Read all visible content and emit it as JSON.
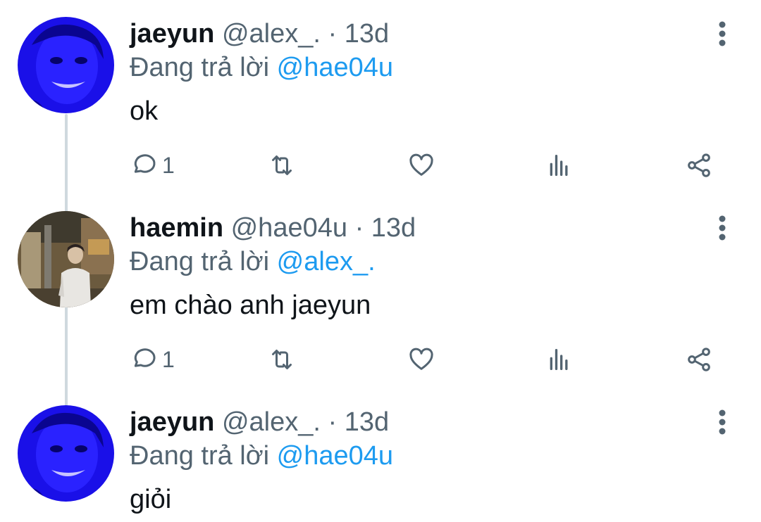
{
  "tweets": [
    {
      "name": "jaeyun",
      "handle": "@alex_.",
      "dot": "·",
      "time": "13d",
      "reply_prefix": "Đang trả lời",
      "reply_to": "@hae04u",
      "text": "ok",
      "reply_count": "1",
      "avatar": "blue-tinted-face"
    },
    {
      "name": "haemin",
      "handle": "@hae04u",
      "dot": "·",
      "time": "13d",
      "reply_prefix": "Đang trả lời",
      "reply_to": "@alex_.",
      "text": "em chào anh jaeyun",
      "reply_count": "1",
      "avatar": "person-in-street-photo"
    },
    {
      "name": "jaeyun",
      "handle": "@alex_.",
      "dot": "·",
      "time": "13d",
      "reply_prefix": "Đang trả lời",
      "reply_to": "@hae04u",
      "text": "giỏi",
      "avatar": "blue-tinted-face"
    }
  ],
  "icons": {
    "reply": "reply-icon",
    "retweet": "retweet-icon",
    "like": "like-icon",
    "views": "views-icon",
    "share": "share-icon",
    "more": "more-icon"
  },
  "colors": {
    "mention": "#1d9bf0",
    "secondary_text": "#536471",
    "thread_line": "#cfd9de",
    "avatar_blue": "#1a10e8"
  }
}
